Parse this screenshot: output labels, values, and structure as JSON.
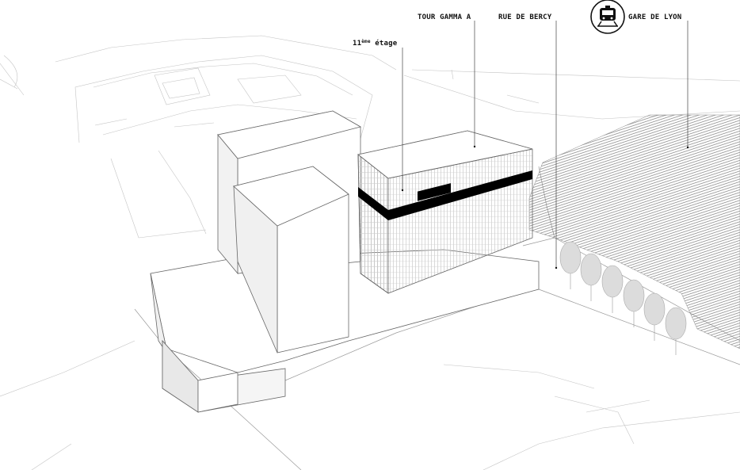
{
  "labels": {
    "tour_gamma": "TOUR GAMMA A",
    "rue_de_bercy": "RUE DE BERCY",
    "gare_de_lyon": "GARE DE LYON",
    "floor_number": "11",
    "floor_sup": "ème",
    "floor_word": " étage"
  },
  "icons": {
    "station": "train-icon"
  },
  "colors": {
    "ink": "#111111",
    "line": "#9a9a9a",
    "highlight": "#000000",
    "background": "#ffffff"
  }
}
